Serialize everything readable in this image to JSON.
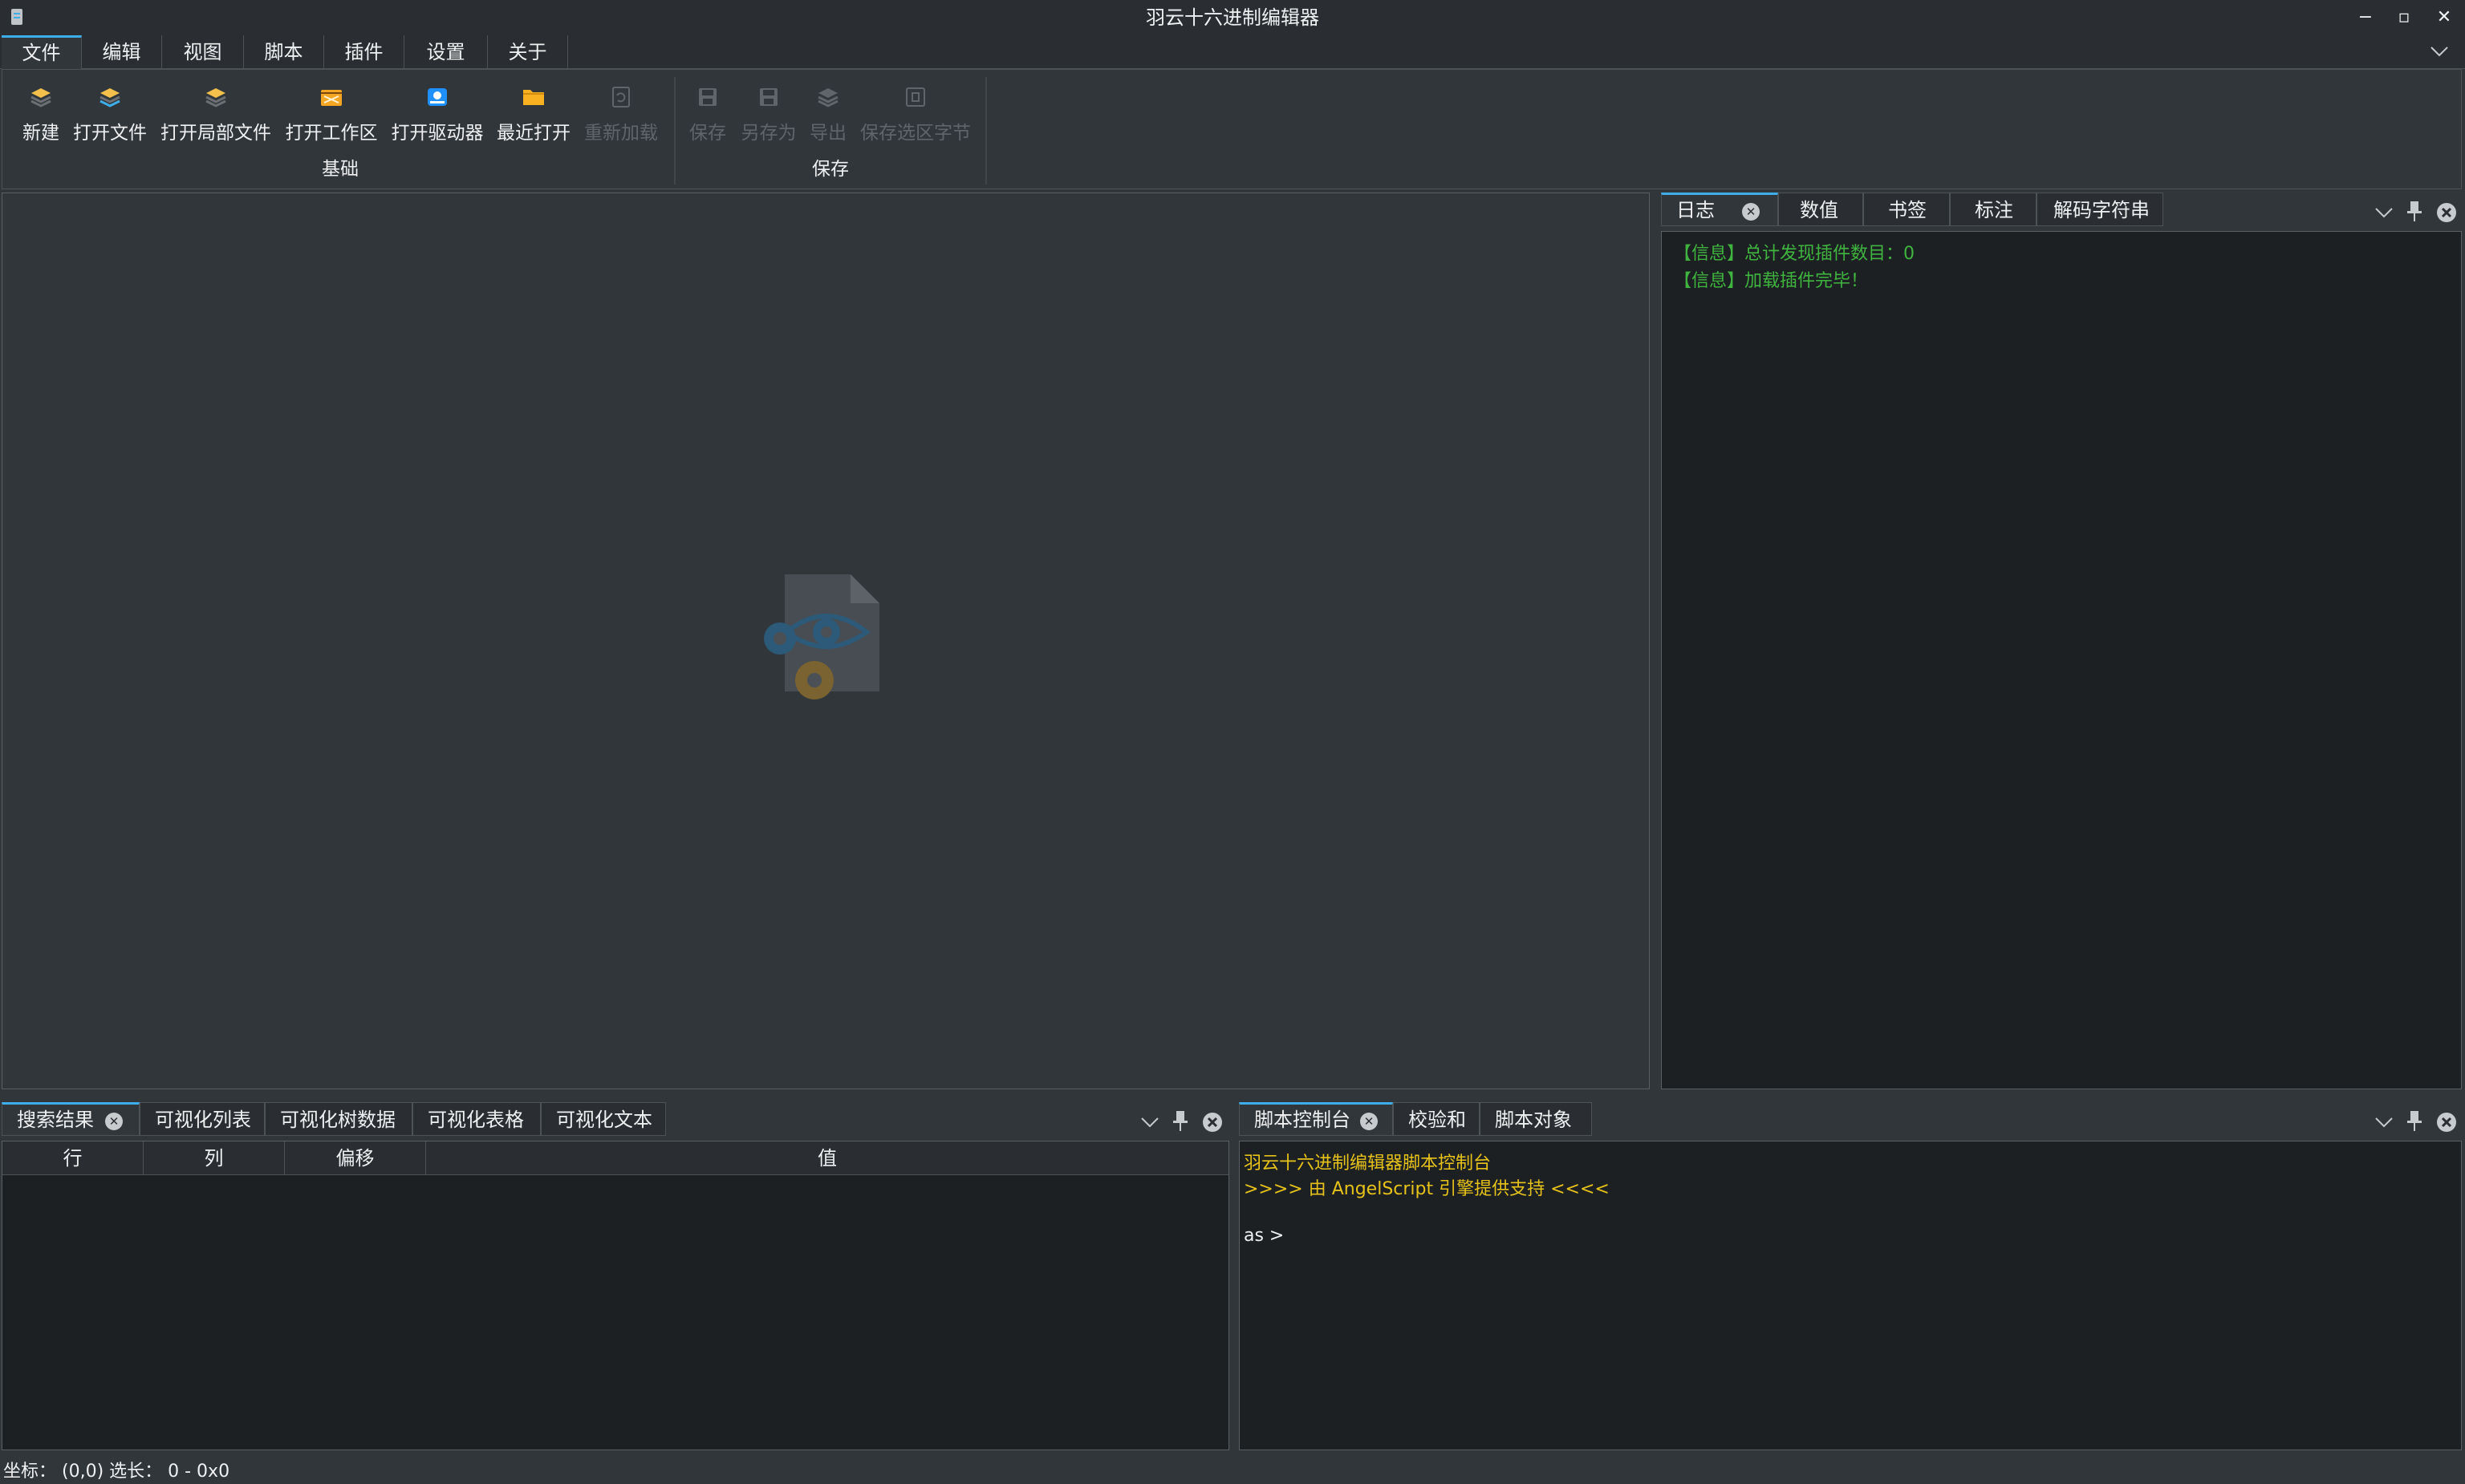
{
  "window": {
    "title": "羽云十六进制编辑器",
    "controls": [
      "−",
      "▫",
      "✕"
    ]
  },
  "ribbon": {
    "tabs": [
      {
        "label": "文件",
        "active": true
      },
      {
        "label": "编辑"
      },
      {
        "label": "视图"
      },
      {
        "label": "脚本"
      },
      {
        "label": "插件"
      },
      {
        "label": "设置"
      },
      {
        "label": "关于"
      }
    ],
    "groups": {
      "basic": {
        "label": "基础",
        "buttons": [
          {
            "label": "新建",
            "icon": "new-file-icon"
          },
          {
            "label": "打开文件",
            "icon": "open-file-icon"
          },
          {
            "label": "打开局部文件",
            "icon": "open-region-icon"
          },
          {
            "label": "打开工作区",
            "icon": "open-workspace-icon"
          },
          {
            "label": "打开驱动器",
            "icon": "open-drive-icon"
          },
          {
            "label": "最近打开",
            "icon": "folder-icon"
          },
          {
            "label": "重新加载",
            "icon": "reload-icon",
            "disabled": true
          }
        ]
      },
      "save": {
        "label": "保存",
        "buttons": [
          {
            "label": "保存",
            "icon": "save-icon",
            "disabled": true
          },
          {
            "label": "另存为",
            "icon": "save-as-icon",
            "disabled": true
          },
          {
            "label": "导出",
            "icon": "export-icon",
            "disabled": true
          },
          {
            "label": "保存选区字节",
            "icon": "save-selection-icon",
            "disabled": true
          }
        ]
      }
    }
  },
  "right_dock": {
    "tabs": [
      "日志",
      "数值",
      "书签",
      "标注",
      "解码字符串"
    ],
    "log_lines": [
      "【信息】总计发现插件数目：0",
      "【信息】加载插件完毕！"
    ]
  },
  "bottom_left_dock": {
    "tabs": [
      "搜索结果",
      "可视化列表",
      "可视化树数据",
      "可视化表格",
      "可视化文本"
    ],
    "columns": [
      "行",
      "列",
      "偏移",
      "值"
    ]
  },
  "bottom_right_dock": {
    "tabs": [
      "脚本控制台",
      "校验和",
      "脚本对象"
    ],
    "console": {
      "line1": "羽云十六进制编辑器脚本控制台",
      "line2": ">>>> 由 AngelScript 引擎提供支持 <<<<",
      "prompt": "as >"
    }
  },
  "status": {
    "text": "坐标：  (0,0) 选长：  0 - 0x0"
  },
  "colors": {
    "accent": "#3daee9",
    "log_green": "#3fb43f",
    "console_yellow": "#e6c21a",
    "background": "#31363b"
  }
}
